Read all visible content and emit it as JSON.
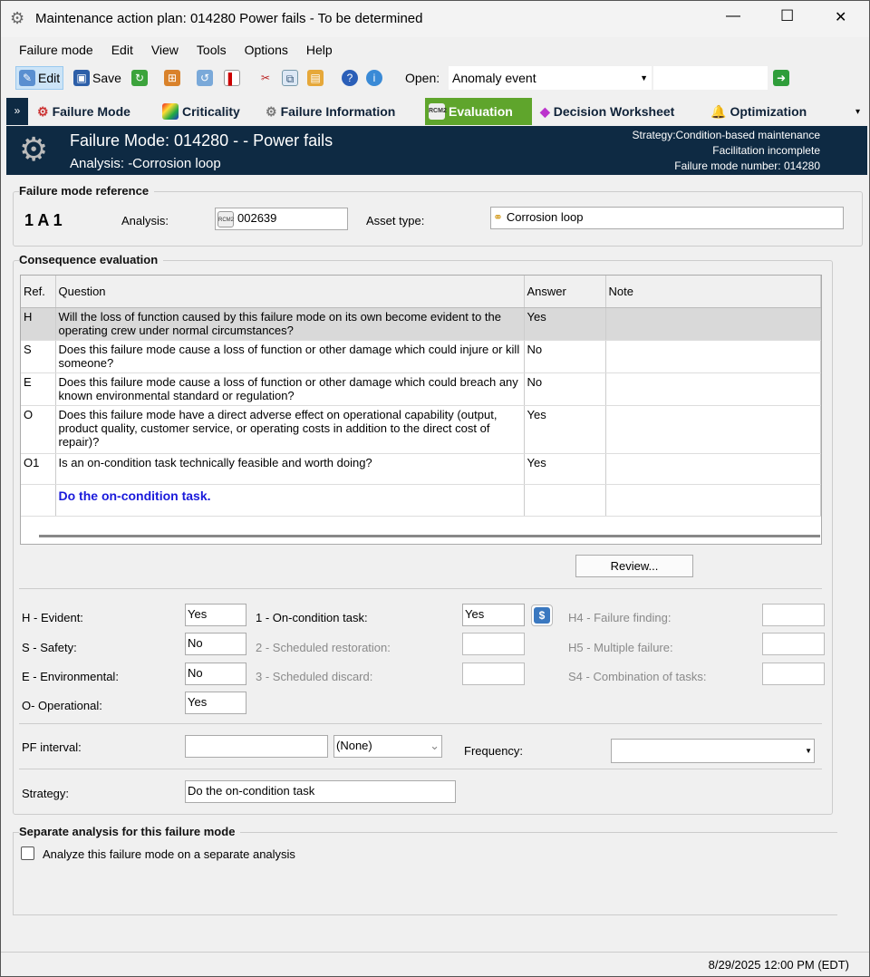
{
  "window": {
    "title": "Maintenance action plan: 014280 Power fails - To be determined",
    "min": "—",
    "max": "☐",
    "close": "✕"
  },
  "menu": [
    "Failure mode",
    "Edit",
    "View",
    "Tools",
    "Options",
    "Help"
  ],
  "toolbar": {
    "edit": "Edit",
    "save": "Save",
    "open_label": "Open:",
    "open_value": "Anomaly event",
    "search_value": ""
  },
  "tabs": [
    {
      "label": "Failure Mode"
    },
    {
      "label": "Criticality"
    },
    {
      "label": "Failure Information"
    },
    {
      "label": "Evaluation"
    },
    {
      "label": "Decision Worksheet"
    },
    {
      "label": "Optimization"
    }
  ],
  "header": {
    "title": "Failure Mode: 014280 -   - Power fails",
    "analysis": "Analysis: -Corrosion loop",
    "strategy": "Strategy:Condition-based maintenance",
    "facilitation": "Facilitation incomplete",
    "fm_number": "Failure mode number: 014280"
  },
  "reference": {
    "group": "Failure mode reference",
    "code": "1 A 1",
    "analysis_label": "Analysis:",
    "analysis_value": "002639",
    "asset_label": "Asset type:",
    "asset_value": "Corrosion loop"
  },
  "consequence": {
    "group": "Consequence evaluation",
    "columns": [
      "Ref.",
      "Question",
      "Answer",
      "Note"
    ],
    "rows": [
      {
        "ref": "H",
        "q": "Will the loss of function caused by this failure mode on its own become evident to the operating crew under normal circumstances?",
        "a": "Yes",
        "note": ""
      },
      {
        "ref": "S",
        "q": "Does this failure mode cause a loss of function or other damage which could injure or kill someone?",
        "a": "No",
        "note": ""
      },
      {
        "ref": "E",
        "q": "Does this failure mode cause a loss of function or other damage which could breach any known environmental standard or regulation?",
        "a": "No",
        "note": ""
      },
      {
        "ref": "O",
        "q": "Does this failure mode have a direct adverse effect on operational capability (output, product quality, customer service, or operating costs in addition to the direct cost of repair)?",
        "a": "Yes",
        "note": ""
      },
      {
        "ref": "O1",
        "q": "Is an on-condition task technically feasible and worth doing?",
        "a": "Yes",
        "note": ""
      }
    ],
    "result": "Do the on-condition task.",
    "review": "Review..."
  },
  "answers": {
    "h_label": "H - Evident:",
    "h": "Yes",
    "s_label": "S - Safety:",
    "s": "No",
    "e_label": "E - Environmental:",
    "e": "No",
    "o_label": "O- Operational:",
    "o": "Yes",
    "t1_label": "1 - On-condition task:",
    "t1": "Yes",
    "t2_label": "2 - Scheduled restoration:",
    "t2": "",
    "t3_label": "3 - Scheduled discard:",
    "t3": "",
    "h4_label": "H4 - Failure finding:",
    "h4": "",
    "h5_label": "H5 - Multiple failure:",
    "h5": "",
    "s4_label": "S4 - Combination of tasks:",
    "s4": ""
  },
  "pf": {
    "label": "PF interval:",
    "value": "",
    "unit": "(None)",
    "freq_label": "Frequency:",
    "freq": ""
  },
  "strategy": {
    "label": "Strategy:",
    "value": "Do the on-condition task"
  },
  "separate": {
    "group": "Separate analysis for this failure mode",
    "checkbox": "Analyze this failure mode on a separate analysis",
    "checked": false
  },
  "status": {
    "datetime": "8/29/2025 12:00 PM (EDT)"
  }
}
